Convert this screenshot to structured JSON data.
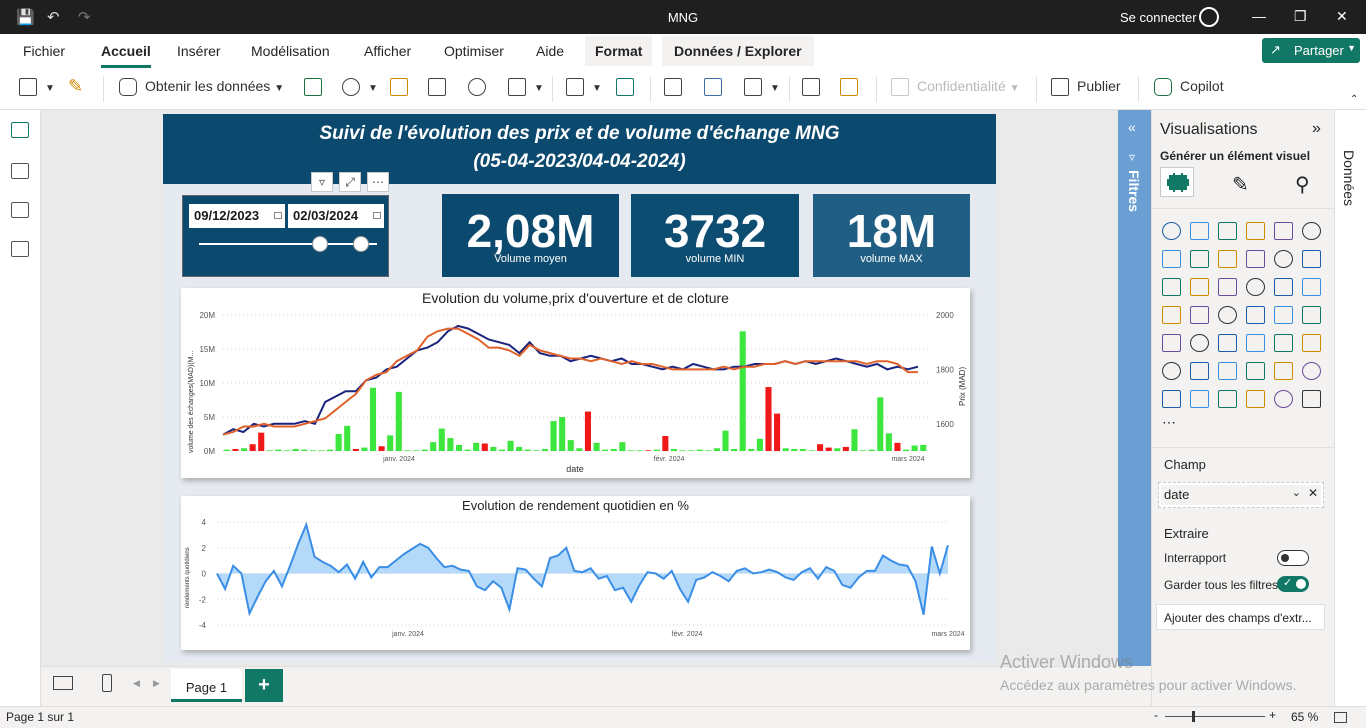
{
  "window": {
    "title": "MNG",
    "signin": "Se connecter"
  },
  "menu": {
    "items": [
      "Fichier",
      "Accueil",
      "Insérer",
      "Modélisation",
      "Afficher",
      "Optimiser",
      "Aide",
      "Format",
      "Données / Explorer"
    ],
    "active": "Accueil",
    "share": "Partager"
  },
  "toolbar": {
    "get_data": "Obtenir les données",
    "confidentiality": "Confidentialité",
    "publish": "Publier",
    "copilot": "Copilot"
  },
  "report": {
    "title_line1": "Suivi de l'évolution des prix et de volume d'échange  MNG",
    "title_line2": "(05-04-2023/04-04-2024)",
    "slicer": {
      "start_date": "09/12/2023",
      "end_date": "02/03/2024"
    },
    "kpis": [
      {
        "value": "2,08M",
        "label": "Volume moyen",
        "color": "#0b4a6e"
      },
      {
        "value": "3732",
        "label": "volume MIN",
        "color": "#0e4d72"
      },
      {
        "value": "18M",
        "label": "volume MAX",
        "color": "#215e84"
      }
    ]
  },
  "chart_data": [
    {
      "type": "bar",
      "title": "Evolution du volume,prix d'ouverture et de cloture",
      "xlabel": "date",
      "ylabel": "volume des échanges(MAD)(M...",
      "y2label": "Prix (MAD)",
      "x_ticks": [
        "janv. 2024",
        "févr. 2024",
        "mars 2024"
      ],
      "y_ticks": [
        "0M",
        "5M",
        "10M",
        "15M",
        "20M"
      ],
      "y2_ticks": [
        "1600",
        "1800",
        "2000"
      ],
      "ylim": [
        0,
        20000000
      ],
      "y2lim": [
        1500,
        2000
      ],
      "volume": [
        0.2,
        0.3,
        0.4,
        1.0,
        2.7,
        0.1,
        0.2,
        0.1,
        0.3,
        0.2,
        0.1,
        0.1,
        0.2,
        2.5,
        3.7,
        0.3,
        0.5,
        9.3,
        0.7,
        2.3,
        8.7,
        0.1,
        0.1,
        0.2,
        1.3,
        3.3,
        1.9,
        0.9,
        0.2,
        1.2,
        1.1,
        0.6,
        0.2,
        1.5,
        0.6,
        0.2,
        0.1,
        0.3,
        4.4,
        5.0,
        1.6,
        0.4,
        5.8,
        1.2,
        0.2,
        0.3,
        1.3,
        0.1,
        0.1,
        0.1,
        0.2,
        2.2,
        0.3,
        0.1,
        0.1,
        0.2,
        0.1,
        0.4,
        3.0,
        0.3,
        17.6,
        0.3,
        1.8,
        9.4,
        5.5,
        0.4,
        0.3,
        0.3,
        0.1,
        1.0,
        0.5,
        0.4,
        0.6,
        3.2,
        0.1,
        0.2,
        7.9,
        2.6,
        1.2,
        0.2,
        0.8,
        0.9
      ],
      "volume_color": [
        "g",
        "r",
        "g",
        "r",
        "r",
        "g",
        "g",
        "g",
        "g",
        "g",
        "g",
        "g",
        "g",
        "g",
        "g",
        "r",
        "g",
        "g",
        "r",
        "g",
        "g",
        "g",
        "g",
        "g",
        "g",
        "g",
        "g",
        "g",
        "g",
        "g",
        "r",
        "g",
        "g",
        "g",
        "g",
        "g",
        "g",
        "g",
        "g",
        "g",
        "g",
        "g",
        "r",
        "g",
        "g",
        "g",
        "g",
        "g",
        "g",
        "r",
        "g",
        "r",
        "g",
        "g",
        "g",
        "g",
        "g",
        "g",
        "g",
        "g",
        "g",
        "g",
        "g",
        "r",
        "r",
        "g",
        "g",
        "g",
        "g",
        "r",
        "r",
        "g",
        "r",
        "g",
        "g",
        "g",
        "g",
        "g",
        "r",
        "g",
        "g",
        "g"
      ],
      "series": [
        {
          "name": "",
          "color": "#1a237e",
          "values": [
            1560,
            1580,
            1570,
            1600,
            1590,
            1600,
            1600,
            1600,
            1610,
            1600,
            1680,
            1700,
            1720,
            1720,
            1760,
            1770,
            1800,
            1810,
            1840,
            1870,
            1880,
            1900,
            1940,
            1960,
            1950,
            1930,
            1910,
            1900,
            1890,
            1860,
            1900,
            1860,
            1850,
            1850,
            1830,
            1840,
            1850,
            1840,
            1830,
            1840,
            1820,
            1820,
            1810,
            1800,
            1810,
            1800,
            1820,
            1810,
            1800,
            1800,
            1810,
            1810,
            1820,
            1820,
            1820,
            1830,
            1820,
            1830,
            1820,
            1830,
            1840,
            1830,
            1820,
            1810,
            1820,
            1800,
            1810,
            1800,
            1810
          ]
        },
        {
          "name": "",
          "color": "#e0622a",
          "values": [
            1560,
            1570,
            1590,
            1590,
            1600,
            1590,
            1590,
            1590,
            1600,
            1610,
            1620,
            1650,
            1680,
            1710,
            1760,
            1780,
            1790,
            1830,
            1850,
            1870,
            1920,
            1940,
            1950,
            1950,
            1930,
            1910,
            1880,
            1880,
            1870,
            1850,
            1890,
            1870,
            1860,
            1850,
            1840,
            1840,
            1830,
            1840,
            1830,
            1820,
            1830,
            1820,
            1820,
            1810,
            1800,
            1800,
            1800,
            1800,
            1800,
            1810,
            1800,
            1810,
            1810,
            1820,
            1820,
            1830,
            1820,
            1830,
            1830,
            1830,
            1830,
            1830,
            1830,
            1820,
            1830,
            1830,
            1820,
            1790,
            1790
          ]
        }
      ]
    },
    {
      "type": "area",
      "title": "Evolution de rendement quotidien en %",
      "ylabel": "rendements quotidiens",
      "x_ticks": [
        "janv. 2024",
        "févr. 2024",
        "mars 2024"
      ],
      "y_ticks": [
        "4",
        "2",
        "0",
        "-2",
        "-4"
      ],
      "ylim": [
        -4,
        4
      ],
      "series": [
        {
          "name": "",
          "color": "#3a8ee6",
          "values": [
            0,
            -1.2,
            0.6,
            0,
            -3.1,
            -1.8,
            -0.6,
            0.2,
            -1.0,
            0.6,
            2.3,
            3.8,
            1.3,
            0.9,
            0.6,
            0.1,
            0.7,
            -0.4,
            0.9,
            -0.3,
            0.5,
            0.5,
            1.0,
            1.5,
            1.9,
            2.3,
            2.0,
            1.2,
            0.5,
            0.6,
            0.3,
            0.2,
            -1.0,
            -1.3,
            -0.6,
            -1.1,
            -2.8,
            0.4,
            0.3,
            -0.4,
            -1.0,
            1.2,
            1.4,
            2.0,
            0.2,
            0.1,
            0.4,
            -0.4,
            -0.2,
            -1.3,
            -1.1,
            -2.2,
            -0.9,
            0.1,
            0,
            -0.4,
            0.2,
            -1.2,
            -2.2,
            -0.5,
            -0.3,
            0.1,
            -0.2,
            -0.6,
            0.2,
            0.4,
            0.0,
            0.1,
            0.3,
            0.1,
            -0.3,
            -0.5,
            0.1,
            0.4,
            -0.4,
            0.5,
            0.2,
            -0.9,
            -1.1,
            -0.3,
            0.2,
            0.2,
            1.4,
            1.0,
            0.7,
            0.6,
            -0.6,
            -3.2,
            2.1,
            0,
            2.2
          ]
        }
      ]
    }
  ],
  "pages": {
    "tab": "Page 1",
    "status": "Page 1 sur 1",
    "zoom": "65 %"
  },
  "visualisations": {
    "header": "Visualisations",
    "build_visual": "Générer un élément visuel",
    "filters": "Filtres",
    "data": "Données",
    "field_label": "Champ",
    "field_value": "date",
    "drillthrough": "Extraire",
    "cross_report": "Interrapport",
    "keep_filters": "Garder tous les filtres",
    "add_fields": "Ajouter des champs d'extr..."
  },
  "watermark": {
    "line1": "Activer Windows",
    "line2": "Accédez aux paramètres pour activer Windows."
  }
}
